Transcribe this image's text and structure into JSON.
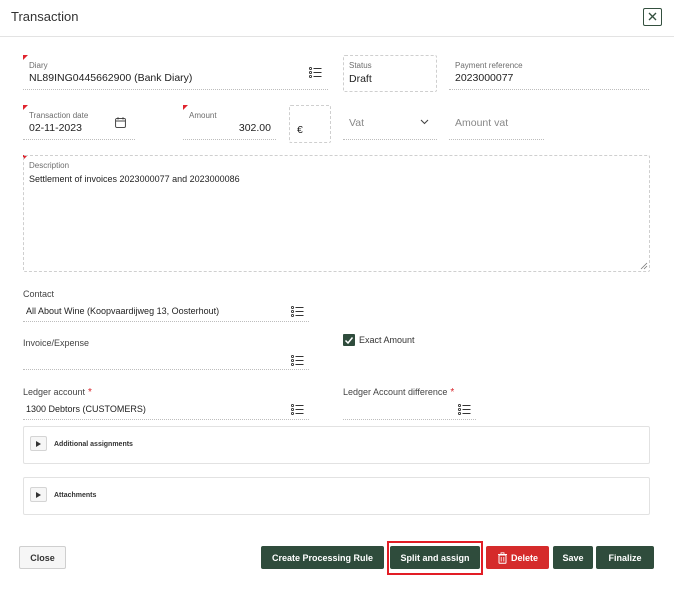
{
  "dialog": {
    "title": "Transaction"
  },
  "icons": {
    "close": "close-icon",
    "list": "list-icon",
    "calendar": "calendar-icon",
    "chevron": "chevron-down-icon",
    "trash": "trash-icon",
    "check": "check-icon"
  },
  "colors": {
    "accent": "#2f4c3c",
    "danger": "#d52b2b",
    "required": "#e0242e"
  },
  "diary": {
    "label": "Diary",
    "value": "NL89ING0445662900 (Bank Diary)"
  },
  "status": {
    "label": "Status",
    "value": "Draft"
  },
  "payment_reference": {
    "label": "Payment reference",
    "value": "2023000077"
  },
  "transaction_date": {
    "label": "Transaction date",
    "value": "02-11-2023"
  },
  "amount": {
    "label": "Amount",
    "value": "302.00",
    "currency": "€"
  },
  "vat": {
    "placeholder": "Vat"
  },
  "amount_vat": {
    "placeholder": "Amount vat"
  },
  "description": {
    "label": "Description",
    "value": "Settlement of invoices 2023000077 and 2023000086"
  },
  "contact": {
    "label": "Contact",
    "value": "All About Wine (Koopvaardijweg 13, Oosterhout)"
  },
  "invoice_expense": {
    "label": "Invoice/Expense",
    "value": ""
  },
  "exact_amount": {
    "label": "Exact Amount",
    "checked": true
  },
  "ledger_account": {
    "label": "Ledger account",
    "required_mark": "*",
    "value": "1300 Debtors (CUSTOMERS)"
  },
  "ledger_difference": {
    "label": "Ledger Account difference",
    "required_mark": "*",
    "value": ""
  },
  "panels": {
    "additional": "Additional assignments",
    "attachments": "Attachments"
  },
  "footer": {
    "close": "Close",
    "create_rule": "Create Processing Rule",
    "split_assign": "Split and assign",
    "delete": "Delete",
    "save": "Save",
    "finalize": "Finalize"
  }
}
